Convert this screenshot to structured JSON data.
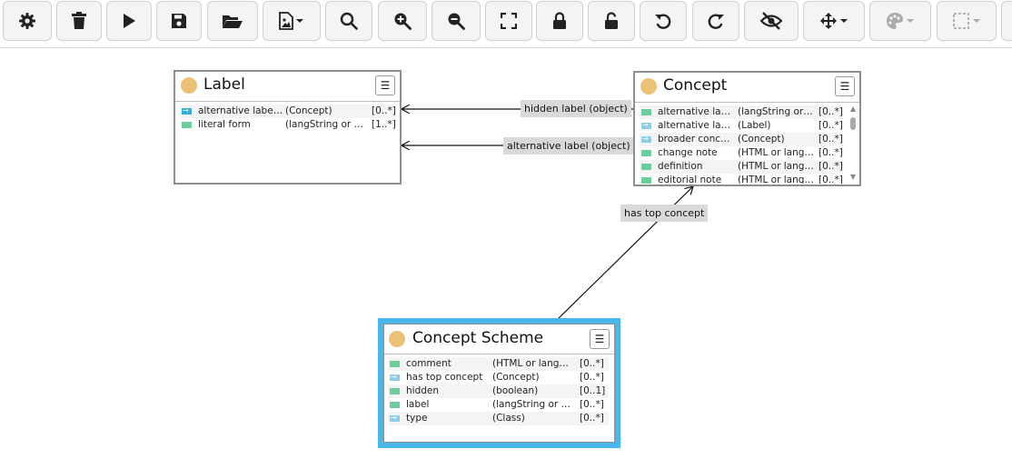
{
  "toolbar": {
    "buttons": [
      {
        "name": "settings-button",
        "icon": "gear-icon"
      },
      {
        "name": "delete-button",
        "icon": "trash-icon"
      },
      {
        "name": "run-button",
        "icon": "play-icon"
      },
      {
        "name": "save-button",
        "icon": "floppy-disk-icon"
      },
      {
        "name": "open-button",
        "icon": "folder-open-icon"
      },
      {
        "name": "export-image-button",
        "icon": "image-file-icon",
        "dropdown": true
      },
      {
        "name": "search-button",
        "icon": "search-icon"
      },
      {
        "name": "zoom-in-button",
        "icon": "zoom-in-icon"
      },
      {
        "name": "zoom-out-button",
        "icon": "zoom-out-icon"
      },
      {
        "name": "fit-to-screen-button",
        "icon": "expand-icon"
      },
      {
        "name": "lock-button",
        "icon": "lock-icon"
      },
      {
        "name": "unlock-button",
        "icon": "unlock-icon"
      },
      {
        "name": "undo-button",
        "icon": "undo-icon"
      },
      {
        "name": "redo-button",
        "icon": "redo-icon"
      },
      {
        "name": "hide-button",
        "icon": "eye-slash-icon"
      },
      {
        "name": "layout-button",
        "icon": "move-arrows-icon",
        "dropdown": true
      },
      {
        "name": "color-button",
        "icon": "palette-icon",
        "dropdown": true,
        "disabled": true
      },
      {
        "name": "border-style-button",
        "icon": "dashed-square-icon",
        "dropdown": true,
        "disabled": true
      }
    ]
  },
  "nodes": {
    "label": {
      "title": "Label",
      "menu_icon": "hamburger-menu-icon",
      "rows": [
        {
          "name": "alternative label for",
          "type": "(Concept)",
          "card": "[0..*]",
          "kind": "rel-dark"
        },
        {
          "name": "literal form",
          "type": "(langString or stri...",
          "card": "[1..*]",
          "kind": "attr"
        }
      ]
    },
    "concept": {
      "title": "Concept",
      "menu_icon": "hamburger-menu-icon",
      "rows": [
        {
          "name": "alternative label",
          "type": "(langString or str...",
          "card": "[0..*]",
          "kind": "attr"
        },
        {
          "name": "alternative label...",
          "type": "(Label)",
          "card": "[0..*]",
          "kind": "rel"
        },
        {
          "name": "broader concept",
          "type": "(Concept)",
          "card": "[0..*]",
          "kind": "rel"
        },
        {
          "name": "change note",
          "type": "(HTML or langSt...",
          "card": "[0..*]",
          "kind": "attr"
        },
        {
          "name": "definition",
          "type": "(HTML or langSt...",
          "card": "[0..*]",
          "kind": "attr"
        },
        {
          "name": "editorial note",
          "type": "(HTML or langSt...",
          "card": "[0..*]",
          "kind": "attr"
        }
      ]
    },
    "concept_scheme": {
      "title": "Concept Scheme",
      "menu_icon": "hamburger-menu-icon",
      "rows": [
        {
          "name": "comment",
          "type": "(HTML or langStri...",
          "card": "[0..*]",
          "kind": "attr"
        },
        {
          "name": "has top concept",
          "type": "(Concept)",
          "card": "[0..*]",
          "kind": "rel"
        },
        {
          "name": "hidden",
          "type": "(boolean)",
          "card": "[0..1]",
          "kind": "attr"
        },
        {
          "name": "label",
          "type": "(langString or stri...",
          "card": "[0..*]",
          "kind": "attr"
        },
        {
          "name": "type",
          "type": "(Class)",
          "card": "[0..*]",
          "kind": "rel"
        }
      ]
    }
  },
  "edges": {
    "hidden_label": "hidden label (object)",
    "alternative_label": "alternative label (object)",
    "has_top_concept": "has top concept"
  },
  "colors": {
    "class_dot": "#ebc177",
    "selection": "#4ab7ea",
    "attribute_icon": "#6ccf9b",
    "relation_icon": "#8ecde6"
  }
}
